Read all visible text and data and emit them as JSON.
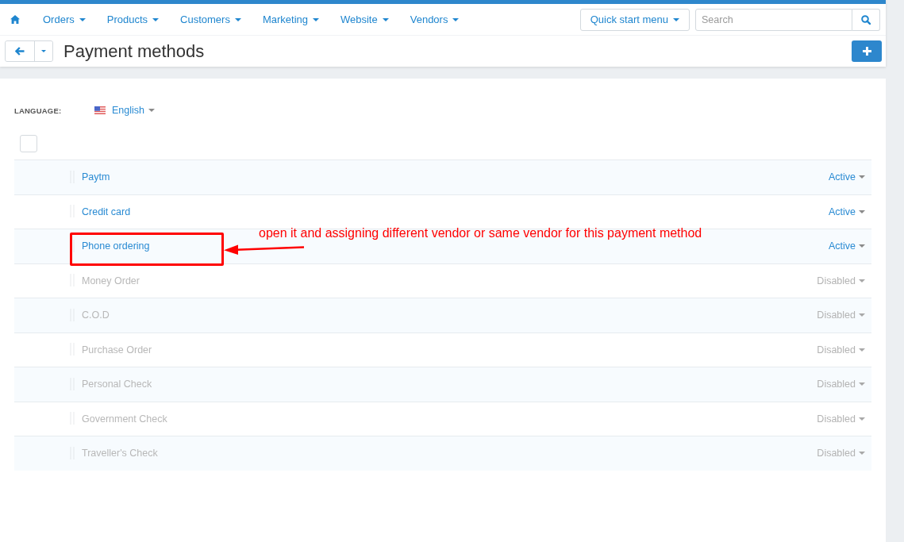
{
  "navbar": {
    "menu": [
      "Orders",
      "Products",
      "Customers",
      "Marketing",
      "Website",
      "Vendors"
    ],
    "quick_start_menu": "Quick start menu",
    "search": {
      "placeholder": "Search"
    }
  },
  "page_title": "Payment methods",
  "language": {
    "label": "LANGUAGE:",
    "value": "English"
  },
  "select_all": {
    "checked": false
  },
  "payment_methods": [
    {
      "name": "Paytm",
      "status": "Active",
      "active": true
    },
    {
      "name": "Credit card",
      "status": "Active",
      "active": true
    },
    {
      "name": "Phone ordering",
      "status": "Active",
      "active": true
    },
    {
      "name": "Money Order",
      "status": "Disabled",
      "active": false
    },
    {
      "name": "C.O.D",
      "status": "Disabled",
      "active": false
    },
    {
      "name": "Purchase Order",
      "status": "Disabled",
      "active": false
    },
    {
      "name": "Personal Check",
      "status": "Disabled",
      "active": false
    },
    {
      "name": "Government Check",
      "status": "Disabled",
      "active": false
    },
    {
      "name": "Traveller's Check",
      "status": "Disabled",
      "active": false
    }
  ],
  "annotation": "open it and assigning different vendor or same vendor for this payment method"
}
